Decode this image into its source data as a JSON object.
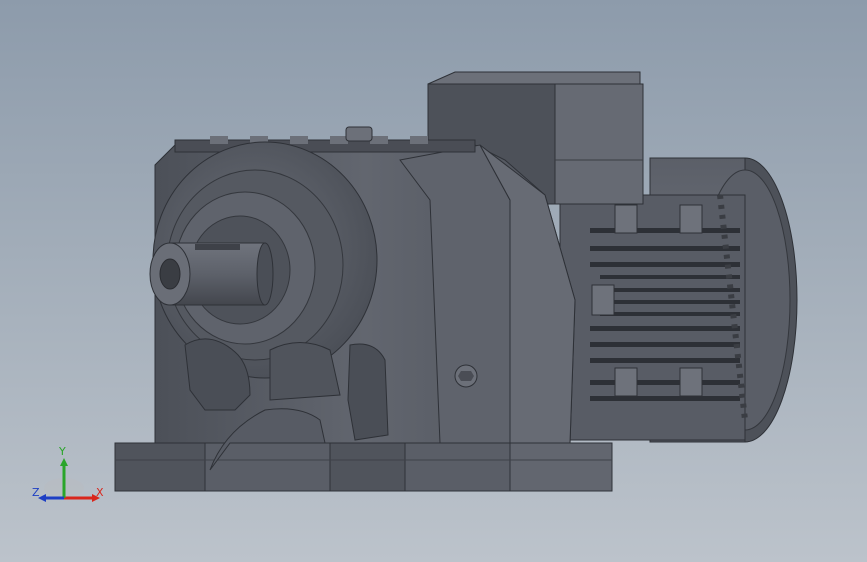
{
  "viewport": {
    "background_top": "#8d9bab",
    "background_bottom": "#bcc3cb",
    "model_color": "#595d66",
    "model_dark": "#3c3f46",
    "model_light": "#71757e"
  },
  "triad": {
    "x_label": "X",
    "y_label": "Y",
    "z_label": "Z",
    "x_color": "#d9261c",
    "y_color": "#2aa52a",
    "z_color": "#1d3fc4"
  }
}
